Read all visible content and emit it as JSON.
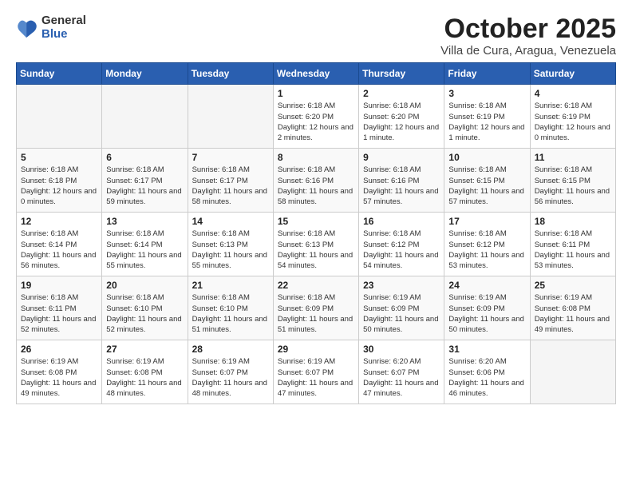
{
  "logo": {
    "general": "General",
    "blue": "Blue"
  },
  "header": {
    "title": "October 2025",
    "subtitle": "Villa de Cura, Aragua, Venezuela"
  },
  "weekdays": [
    "Sunday",
    "Monday",
    "Tuesday",
    "Wednesday",
    "Thursday",
    "Friday",
    "Saturday"
  ],
  "weeks": [
    [
      null,
      null,
      null,
      {
        "day": 1,
        "sunrise": "6:18 AM",
        "sunset": "6:20 PM",
        "daylight": "12 hours and 2 minutes."
      },
      {
        "day": 2,
        "sunrise": "6:18 AM",
        "sunset": "6:20 PM",
        "daylight": "12 hours and 1 minute."
      },
      {
        "day": 3,
        "sunrise": "6:18 AM",
        "sunset": "6:19 PM",
        "daylight": "12 hours and 1 minute."
      },
      {
        "day": 4,
        "sunrise": "6:18 AM",
        "sunset": "6:19 PM",
        "daylight": "12 hours and 0 minutes."
      }
    ],
    [
      {
        "day": 5,
        "sunrise": "6:18 AM",
        "sunset": "6:18 PM",
        "daylight": "12 hours and 0 minutes."
      },
      {
        "day": 6,
        "sunrise": "6:18 AM",
        "sunset": "6:17 PM",
        "daylight": "11 hours and 59 minutes."
      },
      {
        "day": 7,
        "sunrise": "6:18 AM",
        "sunset": "6:17 PM",
        "daylight": "11 hours and 58 minutes."
      },
      {
        "day": 8,
        "sunrise": "6:18 AM",
        "sunset": "6:16 PM",
        "daylight": "11 hours and 58 minutes."
      },
      {
        "day": 9,
        "sunrise": "6:18 AM",
        "sunset": "6:16 PM",
        "daylight": "11 hours and 57 minutes."
      },
      {
        "day": 10,
        "sunrise": "6:18 AM",
        "sunset": "6:15 PM",
        "daylight": "11 hours and 57 minutes."
      },
      {
        "day": 11,
        "sunrise": "6:18 AM",
        "sunset": "6:15 PM",
        "daylight": "11 hours and 56 minutes."
      }
    ],
    [
      {
        "day": 12,
        "sunrise": "6:18 AM",
        "sunset": "6:14 PM",
        "daylight": "11 hours and 56 minutes."
      },
      {
        "day": 13,
        "sunrise": "6:18 AM",
        "sunset": "6:14 PM",
        "daylight": "11 hours and 55 minutes."
      },
      {
        "day": 14,
        "sunrise": "6:18 AM",
        "sunset": "6:13 PM",
        "daylight": "11 hours and 55 minutes."
      },
      {
        "day": 15,
        "sunrise": "6:18 AM",
        "sunset": "6:13 PM",
        "daylight": "11 hours and 54 minutes."
      },
      {
        "day": 16,
        "sunrise": "6:18 AM",
        "sunset": "6:12 PM",
        "daylight": "11 hours and 54 minutes."
      },
      {
        "day": 17,
        "sunrise": "6:18 AM",
        "sunset": "6:12 PM",
        "daylight": "11 hours and 53 minutes."
      },
      {
        "day": 18,
        "sunrise": "6:18 AM",
        "sunset": "6:11 PM",
        "daylight": "11 hours and 53 minutes."
      }
    ],
    [
      {
        "day": 19,
        "sunrise": "6:18 AM",
        "sunset": "6:11 PM",
        "daylight": "11 hours and 52 minutes."
      },
      {
        "day": 20,
        "sunrise": "6:18 AM",
        "sunset": "6:10 PM",
        "daylight": "11 hours and 52 minutes."
      },
      {
        "day": 21,
        "sunrise": "6:18 AM",
        "sunset": "6:10 PM",
        "daylight": "11 hours and 51 minutes."
      },
      {
        "day": 22,
        "sunrise": "6:18 AM",
        "sunset": "6:09 PM",
        "daylight": "11 hours and 51 minutes."
      },
      {
        "day": 23,
        "sunrise": "6:19 AM",
        "sunset": "6:09 PM",
        "daylight": "11 hours and 50 minutes."
      },
      {
        "day": 24,
        "sunrise": "6:19 AM",
        "sunset": "6:09 PM",
        "daylight": "11 hours and 50 minutes."
      },
      {
        "day": 25,
        "sunrise": "6:19 AM",
        "sunset": "6:08 PM",
        "daylight": "11 hours and 49 minutes."
      }
    ],
    [
      {
        "day": 26,
        "sunrise": "6:19 AM",
        "sunset": "6:08 PM",
        "daylight": "11 hours and 49 minutes."
      },
      {
        "day": 27,
        "sunrise": "6:19 AM",
        "sunset": "6:08 PM",
        "daylight": "11 hours and 48 minutes."
      },
      {
        "day": 28,
        "sunrise": "6:19 AM",
        "sunset": "6:07 PM",
        "daylight": "11 hours and 48 minutes."
      },
      {
        "day": 29,
        "sunrise": "6:19 AM",
        "sunset": "6:07 PM",
        "daylight": "11 hours and 47 minutes."
      },
      {
        "day": 30,
        "sunrise": "6:20 AM",
        "sunset": "6:07 PM",
        "daylight": "11 hours and 47 minutes."
      },
      {
        "day": 31,
        "sunrise": "6:20 AM",
        "sunset": "6:06 PM",
        "daylight": "11 hours and 46 minutes."
      },
      null
    ]
  ]
}
